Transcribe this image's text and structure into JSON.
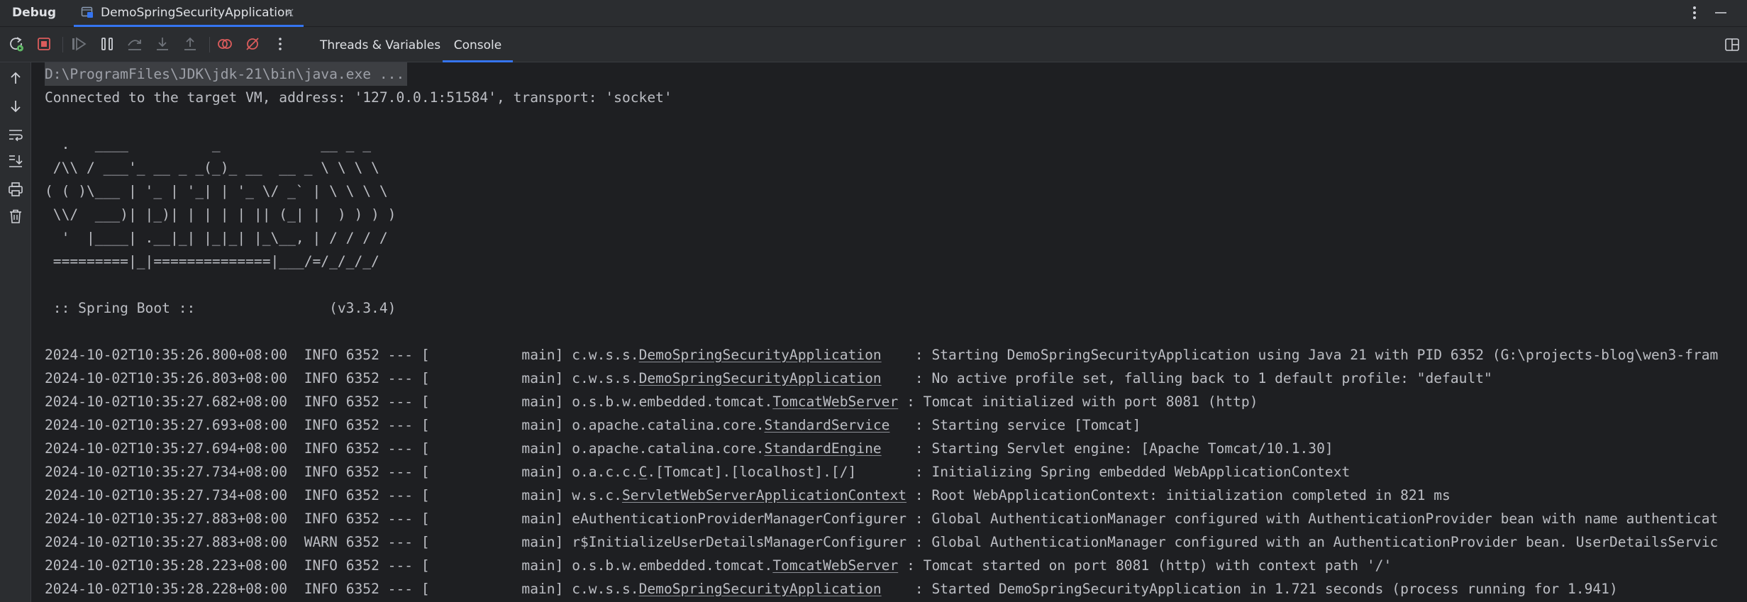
{
  "header": {
    "panel_title": "Debug",
    "run_tab_label": "DemoSpringSecurityApplication"
  },
  "toolbar": {
    "tabs": [
      "Threads & Variables",
      "Console"
    ],
    "active_tab": "Console"
  },
  "console": {
    "command": "D:\\ProgramFiles\\JDK\\jdk-21\\bin\\java.exe ...",
    "connected": "Connected to the target VM, address: '127.0.0.1:51584', transport: 'socket'",
    "banner": [
      "  .   ____          _            __ _ _",
      " /\\\\ / ___'_ __ _ _(_)_ __  __ _ \\ \\ \\ \\",
      "( ( )\\___ | '_ | '_| | '_ \\/ _` | \\ \\ \\ \\",
      " \\\\/  ___)| |_)| | | | | || (_| |  ) ) ) )",
      "  '  |____| .__|_| |_|_| |_\\__, | / / / /",
      " =========|_|==============|___/=/_/_/_/"
    ],
    "spring_boot": " :: Spring Boot ::                (v3.3.4)",
    "logs": [
      {
        "ts": "2024-10-02T10:35:26.800+08:00",
        "level": "INFO",
        "pid": "6352",
        "sep": "--- [",
        "thread": "           main]",
        "logger_prefix": "c.w.s.s.",
        "logger_link": "DemoSpringSecurityApplication",
        "logger_suffix": "",
        "logger_pad": "    ",
        "message": ": Starting DemoSpringSecurityApplication using Java 21 with PID 6352 (G:\\projects-blog\\wen3-fram"
      },
      {
        "ts": "2024-10-02T10:35:26.803+08:00",
        "level": "INFO",
        "pid": "6352",
        "sep": "--- [",
        "thread": "           main]",
        "logger_prefix": "c.w.s.s.",
        "logger_link": "DemoSpringSecurityApplication",
        "logger_suffix": "",
        "logger_pad": "    ",
        "message": ": No active profile set, falling back to 1 default profile: \"default\""
      },
      {
        "ts": "2024-10-02T10:35:27.682+08:00",
        "level": "INFO",
        "pid": "6352",
        "sep": "--- [",
        "thread": "           main]",
        "logger_prefix": "o.s.b.w.embedded.tomcat.",
        "logger_link": "TomcatWebServer",
        "logger_suffix": "",
        "logger_pad": " ",
        "message": ": Tomcat initialized with port 8081 (http)"
      },
      {
        "ts": "2024-10-02T10:35:27.693+08:00",
        "level": "INFO",
        "pid": "6352",
        "sep": "--- [",
        "thread": "           main]",
        "logger_prefix": "o.apache.catalina.core.",
        "logger_link": "StandardService",
        "logger_suffix": "",
        "logger_pad": "   ",
        "message": ": Starting service [Tomcat]"
      },
      {
        "ts": "2024-10-02T10:35:27.694+08:00",
        "level": "INFO",
        "pid": "6352",
        "sep": "--- [",
        "thread": "           main]",
        "logger_prefix": "o.apache.catalina.core.",
        "logger_link": "StandardEngine",
        "logger_suffix": "",
        "logger_pad": "    ",
        "message": ": Starting Servlet engine: [Apache Tomcat/10.1.30]"
      },
      {
        "ts": "2024-10-02T10:35:27.734+08:00",
        "level": "INFO",
        "pid": "6352",
        "sep": "--- [",
        "thread": "           main]",
        "logger_prefix": "o.a.c.c.",
        "logger_link": "C",
        "logger_suffix": ".[Tomcat].[localhost].[/]",
        "logger_pad": "       ",
        "message": ": Initializing Spring embedded WebApplicationContext"
      },
      {
        "ts": "2024-10-02T10:35:27.734+08:00",
        "level": "INFO",
        "pid": "6352",
        "sep": "--- [",
        "thread": "           main]",
        "logger_prefix": "w.s.c.",
        "logger_link": "ServletWebServerApplicationContext",
        "logger_suffix": "",
        "logger_pad": " ",
        "message": ": Root WebApplicationContext: initialization completed in 821 ms"
      },
      {
        "ts": "2024-10-02T10:35:27.883+08:00",
        "level": "INFO",
        "pid": "6352",
        "sep": "--- [",
        "thread": "           main]",
        "logger_prefix": "eAuthenticationProviderManagerConfigurer",
        "logger_link": "",
        "logger_suffix": "",
        "logger_pad": " ",
        "message": ": Global AuthenticationManager configured with AuthenticationProvider bean with name authenticat"
      },
      {
        "ts": "2024-10-02T10:35:27.883+08:00",
        "level": "WARN",
        "pid": "6352",
        "sep": "--- [",
        "thread": "           main]",
        "logger_prefix": "r$InitializeUserDetailsManagerConfigurer",
        "logger_link": "",
        "logger_suffix": "",
        "logger_pad": " ",
        "message": ": Global AuthenticationManager configured with an AuthenticationProvider bean. UserDetailsServic"
      },
      {
        "ts": "2024-10-02T10:35:28.223+08:00",
        "level": "INFO",
        "pid": "6352",
        "sep": "--- [",
        "thread": "           main]",
        "logger_prefix": "o.s.b.w.embedded.tomcat.",
        "logger_link": "TomcatWebServer",
        "logger_suffix": "",
        "logger_pad": " ",
        "message": ": Tomcat started on port 8081 (http) with context path '/'"
      },
      {
        "ts": "2024-10-02T10:35:28.228+08:00",
        "level": "INFO",
        "pid": "6352",
        "sep": "--- [",
        "thread": "           main]",
        "logger_prefix": "c.w.s.s.",
        "logger_link": "DemoSpringSecurityApplication",
        "logger_suffix": "",
        "logger_pad": "    ",
        "message": ": Started DemoSpringSecurityApplication in 1.721 seconds (process running for 1.941)"
      }
    ]
  },
  "colors": {
    "panel_bg": "#2b2d30",
    "console_bg": "#1e1f22",
    "text": "#bcbec4",
    "accent": "#3574f0",
    "stop_red": "#db5c5c"
  },
  "icons": {
    "top_right": [
      "more-vertical-icon",
      "minimize-icon"
    ],
    "toolbar": [
      "rerun-icon",
      "stop-icon",
      "resume-icon",
      "pause-icon",
      "step-over-icon",
      "step-into-icon",
      "step-out-icon",
      "view-breakpoints-icon",
      "mute-breakpoints-icon",
      "more-vertical-icon"
    ],
    "gutter": [
      "up-arrow-icon",
      "down-arrow-icon",
      "soft-wrap-icon",
      "scroll-to-end-icon",
      "print-icon",
      "clear-all-icon"
    ]
  }
}
